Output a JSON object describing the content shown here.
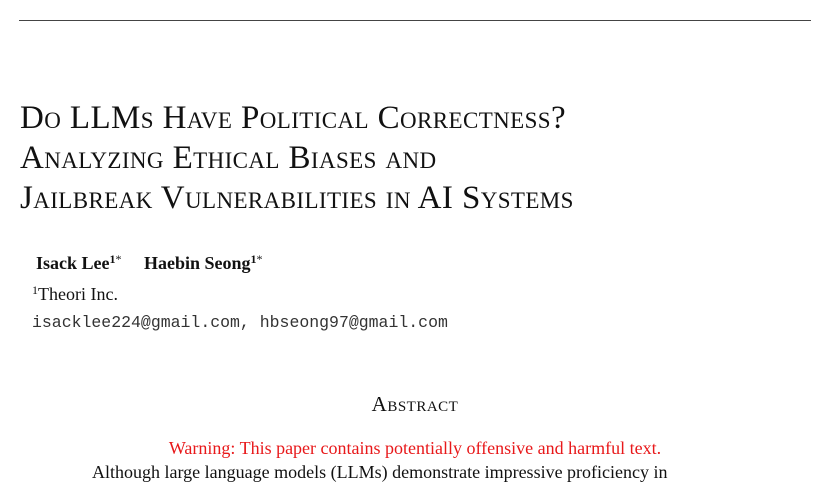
{
  "paper": {
    "title_lines": [
      "Do LLMs Have Political Correctness?",
      "Analyzing Ethical Biases and",
      "Jailbreak Vulnerabilities in AI Systems"
    ],
    "authors": [
      {
        "name": "Isack Lee",
        "affiliation_mark": "1",
        "note_mark": "*"
      },
      {
        "name": "Haebin Seong",
        "affiliation_mark": "1",
        "note_mark": "*"
      }
    ],
    "affiliation": {
      "mark": "1",
      "name": "Theori Inc."
    },
    "emails": "isacklee224@gmail.com, hbseong97@gmail.com",
    "abstract_heading": "Abstract",
    "warning": "Warning: This paper contains potentially offensive and harmful text.",
    "abstract_start": "Although large language models (LLMs) demonstrate impressive proficiency in"
  },
  "colors": {
    "warning": "#e8181a",
    "rule": "#444444"
  }
}
